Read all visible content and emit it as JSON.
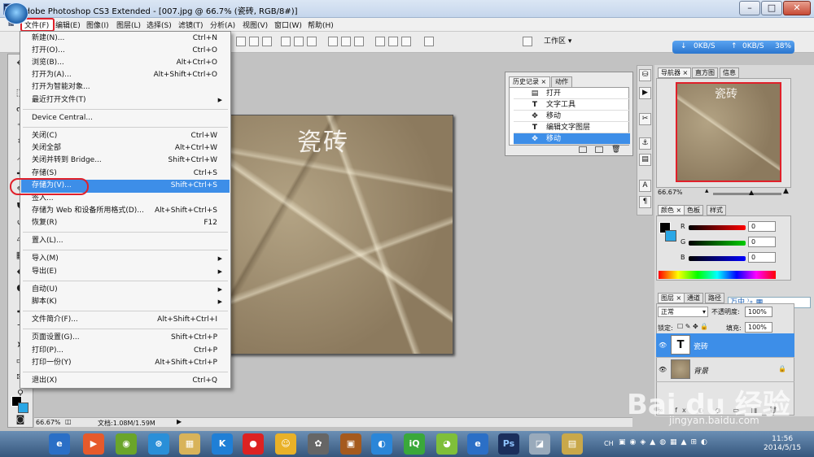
{
  "window": {
    "app_logo": "Ps",
    "title": "Adobe Photoshop CS3 Extended - [007.jpg @ 66.7% (瓷砖, RGB/8#)]",
    "minimize": "–",
    "maximize": "□",
    "close": "✕"
  },
  "menubar": {
    "items": [
      "文件(F)",
      "编辑(E)",
      "图像(I)",
      "图层(L)",
      "选择(S)",
      "滤镜(T)",
      "分析(A)",
      "视图(V)",
      "窗口(W)",
      "帮助(H)"
    ]
  },
  "optionsbar": {
    "workspace_label": "工作区 ▾",
    "speed": {
      "down": "0KB/S",
      "up": "0KB/S",
      "percent": "38%"
    }
  },
  "file_menu": {
    "items": [
      {
        "label": "新建(N)...",
        "shortcut": "Ctrl+N"
      },
      {
        "label": "打开(O)...",
        "shortcut": "Ctrl+O"
      },
      {
        "label": "浏览(B)...",
        "shortcut": "Alt+Ctrl+O"
      },
      {
        "label": "打开为(A)...",
        "shortcut": "Alt+Shift+Ctrl+O"
      },
      {
        "label": "打开为智能对象...",
        "shortcut": ""
      },
      {
        "label": "最近打开文件(T)",
        "shortcut": ""
      },
      {
        "label": "Device Central...",
        "shortcut": ""
      },
      {
        "label": "关闭(C)",
        "shortcut": "Ctrl+W"
      },
      {
        "label": "关闭全部",
        "shortcut": "Alt+Ctrl+W"
      },
      {
        "label": "关闭并转到 Bridge...",
        "shortcut": "Shift+Ctrl+W"
      },
      {
        "label": "存储(S)",
        "shortcut": "Ctrl+S"
      },
      {
        "label": "存储为(V)...",
        "shortcut": "Shift+Ctrl+S"
      },
      {
        "label": "签入...",
        "shortcut": ""
      },
      {
        "label": "存储为 Web 和设备所用格式(D)...",
        "shortcut": "Alt+Shift+Ctrl+S"
      },
      {
        "label": "恢复(R)",
        "shortcut": "F12"
      },
      {
        "label": "置入(L)...",
        "shortcut": ""
      },
      {
        "label": "导入(M)",
        "shortcut": ""
      },
      {
        "label": "导出(E)",
        "shortcut": ""
      },
      {
        "label": "自动(U)",
        "shortcut": ""
      },
      {
        "label": "脚本(K)",
        "shortcut": ""
      },
      {
        "label": "文件简介(F)...",
        "shortcut": "Alt+Shift+Ctrl+I"
      },
      {
        "label": "页面设置(G)...",
        "shortcut": "Shift+Ctrl+P"
      },
      {
        "label": "打印(P)...",
        "shortcut": "Ctrl+P"
      },
      {
        "label": "打印一份(Y)",
        "shortcut": "Alt+Shift+Ctrl+P"
      },
      {
        "label": "退出(X)",
        "shortcut": "Ctrl+Q"
      }
    ],
    "submenu_arrow": "▶"
  },
  "canvas": {
    "image_text": "瓷砖"
  },
  "statusbar": {
    "zoom": "66.67%",
    "doc": "文档:1.08M/1.59M"
  },
  "history_panel": {
    "tabs": [
      "历史记录",
      "动作"
    ],
    "close": "×",
    "rows": [
      {
        "icon": "▤",
        "label": "打开"
      },
      {
        "icon": "T",
        "label": "文字工具"
      },
      {
        "icon": "✥",
        "label": "移动"
      },
      {
        "icon": "T",
        "label": "编辑文字图层"
      },
      {
        "icon": "✥",
        "label": "移动"
      }
    ]
  },
  "navigator": {
    "tabs": [
      "导航器",
      "直方图",
      "信息"
    ],
    "close": "×",
    "thumb_text": "瓷砖",
    "zoom": "66.67%"
  },
  "color_panel": {
    "tabs": [
      "颜色",
      "色板",
      "样式"
    ],
    "close": "×",
    "channels": [
      {
        "label": "R",
        "value": "0"
      },
      {
        "label": "G",
        "value": "0"
      },
      {
        "label": "B",
        "value": "0"
      }
    ]
  },
  "layers_panel": {
    "tabs": [
      "图层",
      "通道",
      "路径"
    ],
    "close": "×",
    "blend_mode": "正常",
    "opacity_label": "不透明度:",
    "opacity_value": "100%",
    "lock_label": "锁定:",
    "fill_label": "填充:",
    "fill_value": "100%",
    "ime_text": "万中 ⁾∘ ▦",
    "layers": [
      {
        "thumb": "T",
        "name": "瓷砖",
        "selected": true
      },
      {
        "thumb": "",
        "name": "背景",
        "selected": false
      }
    ]
  },
  "watermark": {
    "brand": "Bai du 经验",
    "url": "jingyan.baidu.com"
  },
  "taskbar": {
    "lang": "CH",
    "time": "11:56",
    "date": "2014/5/15",
    "app_icons": [
      "e",
      "▶",
      "◉",
      "⊛",
      "▦",
      "K",
      "●",
      "☺",
      "✿",
      "▣",
      "◐",
      "iQ",
      "◕",
      "e",
      "Ps",
      "◪",
      "▤"
    ]
  }
}
